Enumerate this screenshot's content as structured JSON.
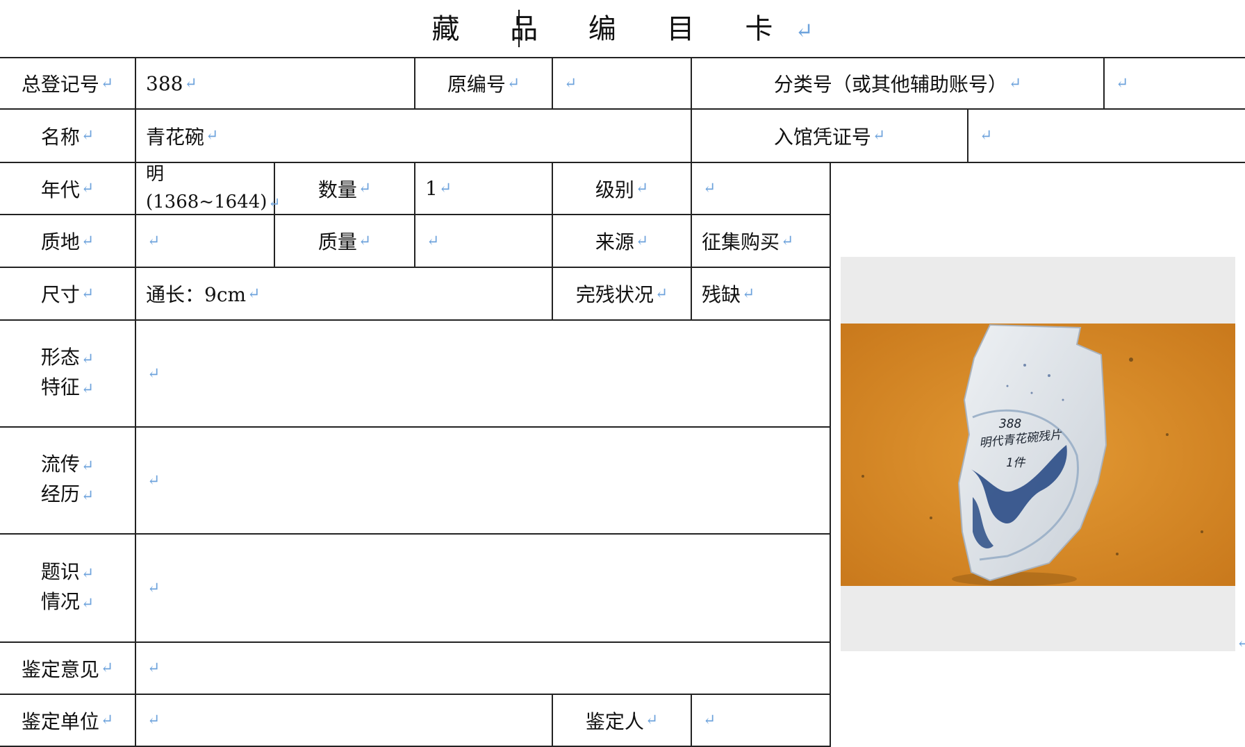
{
  "title": "藏 品 编 目 卡",
  "return_mark": "↵",
  "fields": {
    "total_reg_no": {
      "label": "总登记号",
      "value": "388"
    },
    "original_no": {
      "label": "原编号",
      "value": ""
    },
    "class_no": {
      "label": "分类号（或其他辅助账号）",
      "value": ""
    },
    "name": {
      "label": "名称",
      "value": "青花碗"
    },
    "entry_voucher": {
      "label": "入馆凭证号",
      "value": ""
    },
    "era": {
      "label": "年代",
      "value_line1": "明",
      "value_line2": "(1368~1644)"
    },
    "quantity": {
      "label": "数量",
      "value": "1"
    },
    "grade": {
      "label": "级别",
      "value": ""
    },
    "material": {
      "label": "质地",
      "value": ""
    },
    "mass": {
      "label": "质量",
      "value": ""
    },
    "source": {
      "label": "来源",
      "value": "征集购买"
    },
    "size": {
      "label": "尺寸",
      "value": "通长：9cm"
    },
    "condition": {
      "label": "完残状况",
      "value": "残缺"
    },
    "form": {
      "label_line1": "形态",
      "label_line2": "特征",
      "value": ""
    },
    "provenance": {
      "label_line1": "流传",
      "label_line2": "经历",
      "value": ""
    },
    "inscription": {
      "label_line1": "题识",
      "label_line2": "情况",
      "value": ""
    },
    "opinion": {
      "label": "鉴定意见",
      "value": ""
    },
    "unit": {
      "label": "鉴定单位",
      "value": ""
    },
    "appraiser": {
      "label": "鉴定人",
      "value": ""
    }
  },
  "photo": {
    "description_icon": "blue-and-white-bowl-fragment-photo",
    "handwritten_lines": [
      "388",
      "明代青花碗残片",
      "1件"
    ],
    "colors": {
      "background": "#d98a22",
      "porcelain": "#dfe4ea",
      "cobalt": "#2b4d86"
    }
  }
}
